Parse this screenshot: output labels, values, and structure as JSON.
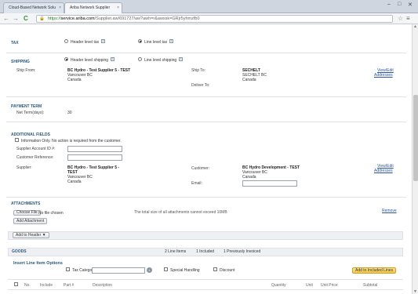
{
  "browser": {
    "tabs": [
      {
        "label": "Cloud-Based Network Solu"
      },
      {
        "label": "Ariba Network Supplier"
      }
    ],
    "url_scheme": "https://",
    "url_host": "service.ariba.com",
    "url_path": "/Supplier.aw/691727/aw?awh=r&awssk=GRjr5yhmzfb0",
    "minimize": "–",
    "maximize": "□",
    "close": "✕",
    "back": "←",
    "forward": "→",
    "reload": "C"
  },
  "tax": {
    "title": "TAX",
    "option_header": "Header level tax",
    "option_line": "Line level tax",
    "selected": "line"
  },
  "shipping": {
    "title": "SHIPPING",
    "option_header": "Header level shipping",
    "option_line": "Line level shipping",
    "selected": "header",
    "ship_from_label": "Ship From:",
    "ship_from_name": "BC Hydro - Test Supplier 5 - TEST",
    "ship_from_city": "Vancouver BC",
    "ship_from_country": "Canada",
    "ship_to_label": "Ship To:",
    "ship_to_name": "SECHELT",
    "ship_to_city": "SECHELT BC",
    "ship_to_country": "Canada",
    "deliver_to_label": "Deliver To:",
    "view_edit": "View/Edit",
    "addresses": "Addresses"
  },
  "payment": {
    "title": "PAYMENT TERM",
    "net_term_label": "Net Term(days):",
    "net_term_value": "30"
  },
  "additional": {
    "title": "ADDITIONAL FIELDS",
    "info_only": "Information Only. No action is required from the customer.",
    "supplier_account_label": "Supplier Account ID #:",
    "customer_reference_label": "Customer Reference:",
    "supplier_label": "Supplier:",
    "supplier_name_1": "BC Hydro - Test Supplier 5 -",
    "supplier_name_2": "TEST",
    "supplier_city": "Vancouver BC",
    "supplier_country": "Canada",
    "customer_label": "Customer:",
    "customer_name": "BC Hydro Development - TEST",
    "customer_city": "Vancouver BC",
    "customer_country": "Canada",
    "email_label": "Email:",
    "view_edit": "View/Edit",
    "addresses": "Addresses"
  },
  "attachments": {
    "title": "ATTACHMENTS",
    "choose_file": "Choose File",
    "no_file": "No file chosen",
    "size_note": "The total size of all attachments cannot exceed 10MB",
    "remove": "Remove",
    "add_attachment": "Add Attachment",
    "add_to_header": "Add to Header ▼"
  },
  "goods": {
    "title": "GOODS",
    "summary_line_items": "2 Line Items",
    "summary_included": "1 Included",
    "summary_invoiced": "1 Previously Invoiced"
  },
  "insert_line": {
    "title": "Insert Line Item Options",
    "tax_category_label": "Tax Category:",
    "special_handling": "Special Handling",
    "discount": "Discount",
    "add_to_included": "Add to Included Lines"
  },
  "columns": [
    "No.",
    "Include",
    "Part #",
    "Description",
    "Quantity",
    "Unit",
    "Unit Price",
    "Subtotal"
  ]
}
